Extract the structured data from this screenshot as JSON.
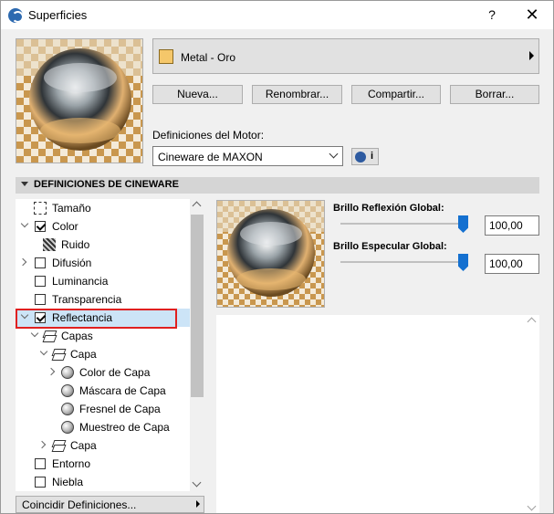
{
  "window": {
    "title": "Superficies",
    "help_label": "?",
    "close_label": "✕"
  },
  "material": {
    "name": "Metal - Oro",
    "swatch_color": "#f5c76a"
  },
  "buttons": {
    "new": "Nueva...",
    "rename": "Renombrar...",
    "share": "Compartir...",
    "delete": "Borrar..."
  },
  "engine": {
    "label": "Definiciones del Motor:",
    "selected": "Cineware de MAXON",
    "info_label": "i"
  },
  "section": {
    "title": "DEFINICIONES DE CINEWARE"
  },
  "tree": {
    "items": [
      {
        "label": "Tamaño"
      },
      {
        "label": "Color"
      },
      {
        "label": "Ruido"
      },
      {
        "label": "Difusión"
      },
      {
        "label": "Luminancia"
      },
      {
        "label": "Transparencia"
      },
      {
        "label": "Reflectancia"
      },
      {
        "label": "Capas"
      },
      {
        "label": "Capa"
      },
      {
        "label": "Color de Capa"
      },
      {
        "label": "Máscara de Capa"
      },
      {
        "label": "Fresnel de Capa"
      },
      {
        "label": "Muestreo de Capa"
      },
      {
        "label": "Capa"
      },
      {
        "label": "Entorno"
      },
      {
        "label": "Niebla"
      }
    ]
  },
  "match_button": {
    "label": "Coincidir Definiciones..."
  },
  "params": {
    "reflection": {
      "label": "Brillo Reflexión Global:",
      "value": "100,00",
      "level": 1.0
    },
    "specular": {
      "label": "Brillo Especular Global:",
      "value": "100,00",
      "level": 1.0
    }
  },
  "colors": {
    "accent": "#1470d0",
    "selection": "#cce4f7",
    "highlight_outline": "#e02020"
  }
}
